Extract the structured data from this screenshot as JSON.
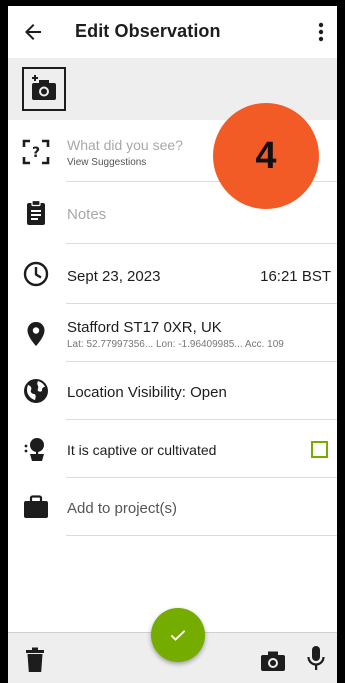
{
  "header": {
    "title": "Edit Observation",
    "back_icon": "arrow-back-icon",
    "menu_icon": "more-vertical-icon"
  },
  "photo_strip": {
    "add_photo_icon": "add-photo-camera-icon"
  },
  "fields": {
    "identification": {
      "placeholder": "What did you see?",
      "suggestions_link": "View Suggestions",
      "icon": "identify-scan-icon"
    },
    "notes": {
      "placeholder": "Notes",
      "icon": "clipboard-icon"
    },
    "date": {
      "value": "Sept 23, 2023",
      "time": "16:21 BST",
      "icon": "clock-icon"
    },
    "location": {
      "name": "Stafford ST17 0XR, UK",
      "coords": "Lat: 52.77997356...  Lon: -1.96409985...  Acc. 109",
      "icon": "location-pin-icon"
    },
    "visibility": {
      "label": "Location Visibility: Open",
      "icon": "globe-icon"
    },
    "captive": {
      "label": "It is captive or cultivated",
      "checked": false,
      "icon": "potted-plant-icon"
    },
    "projects": {
      "placeholder": "Add to project(s)",
      "icon": "briefcase-icon"
    }
  },
  "overlay_badge": {
    "label": "4",
    "color": "#f35b26"
  },
  "bottom_bar": {
    "delete_icon": "trash-icon",
    "save_icon": "checkmark-icon",
    "camera_icon": "camera-icon",
    "mic_icon": "microphone-icon"
  },
  "colors": {
    "accent": "#74ac00",
    "text": "#1d1d1d",
    "badge": "#f35b26"
  }
}
